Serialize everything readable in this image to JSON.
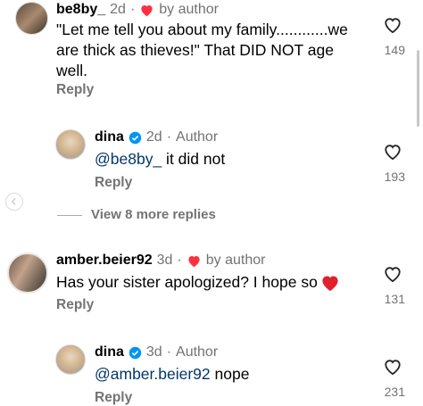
{
  "comments": [
    {
      "username": "be8by_",
      "time": "2d",
      "sep": "·",
      "badge_text": "by author",
      "text": "\"Let me tell you about my family............we are thick as thieves!\" That DID NOT age well.",
      "reply_label": "Reply",
      "likes": "149"
    },
    {
      "username": "dina",
      "time": "2d",
      "sep": "·",
      "role": "Author",
      "mention": "@be8by_",
      "text": " it did not",
      "reply_label": "Reply",
      "likes": "193"
    },
    {
      "view_more": "View 8 more replies"
    },
    {
      "username": "amber.beier92",
      "time": "3d",
      "sep": "·",
      "badge_text": "by author",
      "text": "Has your sister apologized? I hope so",
      "reply_label": "Reply",
      "likes": "131"
    },
    {
      "username": "dina",
      "time": "3d",
      "sep": "·",
      "role": "Author",
      "mention": "@amber.beier92",
      "text": " nope",
      "reply_label": "Reply",
      "likes": "231"
    }
  ],
  "colors": {
    "heart_red": "#ff3040",
    "verified_blue": "#0095f6",
    "mention": "#00376b",
    "meta": "#737373"
  }
}
